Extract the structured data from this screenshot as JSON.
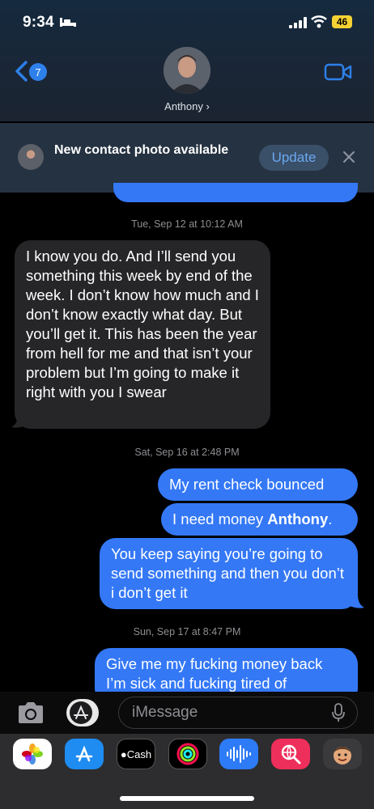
{
  "status_bar": {
    "time": "9:34",
    "battery": "46"
  },
  "header": {
    "back_badge": "7",
    "contact_name": "Anthony ›"
  },
  "banner": {
    "text": "New contact photo available",
    "update_label": "Update"
  },
  "thread": {
    "timestamps": [
      "Tue, Sep 12 at 10:12 AM",
      "Sat, Sep 16 at 2:48 PM",
      "Sun, Sep 17 at 8:47 PM"
    ],
    "messages": [
      {
        "from": "them",
        "text": "I know you do. And I’ll send you something this week by end of the week. I don’t know how much and I don’t know exactly what day. But you’ll get it. This has been the year from hell for me and that isn’t your problem but I’m going to make it right with you I swear"
      },
      {
        "from": "me",
        "text": "My rent check bounced"
      },
      {
        "from": "me",
        "text_pre": "I need money ",
        "text_bold": "Anthony",
        "text_post": "."
      },
      {
        "from": "me",
        "text": "You keep saying you’re going to send something and then you don’t i don’t get it"
      },
      {
        "from": "me",
        "text": "Give me my fucking money back I’m sick and fucking tired of"
      }
    ]
  },
  "compose": {
    "placeholder": "iMessage"
  },
  "app_drawer": {
    "items": [
      "photos-icon",
      "app-store-icon",
      "cash-icon",
      "activity-icon",
      "audio-message-icon",
      "search-images-icon",
      "memoji-icon"
    ],
    "cash_label": "Cash"
  },
  "colors": {
    "outgoing": "#3478f6",
    "incoming": "#262628",
    "accent": "#2e80ea"
  }
}
